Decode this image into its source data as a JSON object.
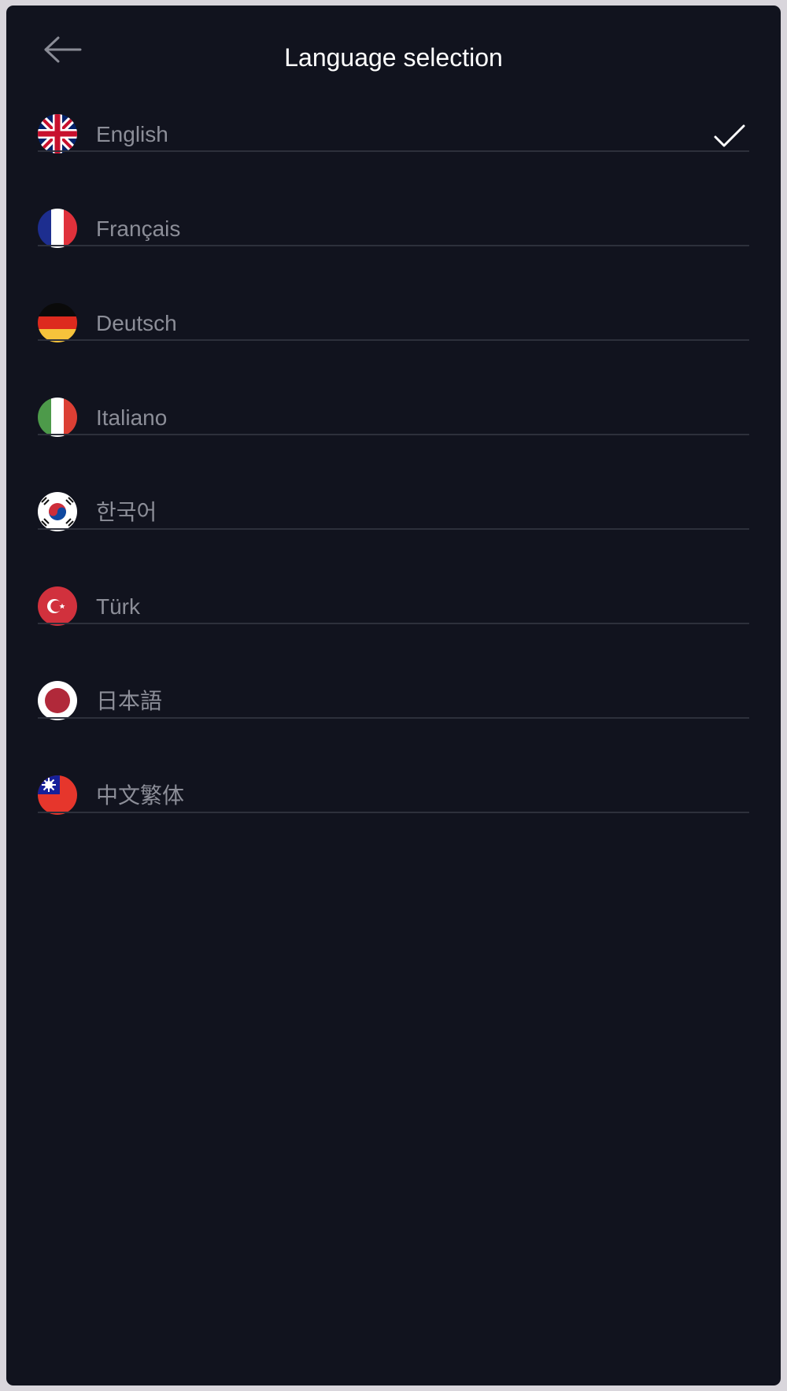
{
  "header": {
    "title": "Language selection",
    "back_icon": "arrow-left-icon"
  },
  "languages": [
    {
      "label": "English",
      "flag": "uk-flag-icon",
      "selected": true
    },
    {
      "label": "Français",
      "flag": "france-flag-icon",
      "selected": false
    },
    {
      "label": "Deutsch",
      "flag": "germany-flag-icon",
      "selected": false
    },
    {
      "label": "Italiano",
      "flag": "italy-flag-icon",
      "selected": false
    },
    {
      "label": "한국어",
      "flag": "korea-flag-icon",
      "selected": false
    },
    {
      "label": "Türk",
      "flag": "turkey-flag-icon",
      "selected": false
    },
    {
      "label": "日本語",
      "flag": "japan-flag-icon",
      "selected": false
    },
    {
      "label": "中文繁体",
      "flag": "taiwan-flag-icon",
      "selected": false
    }
  ],
  "colors": {
    "background": "#11131e",
    "title": "#ffffff",
    "label": "#8c8e98",
    "divider": "#2d303b",
    "check": "#ffffff"
  },
  "selected_icon": "checkmark-icon"
}
